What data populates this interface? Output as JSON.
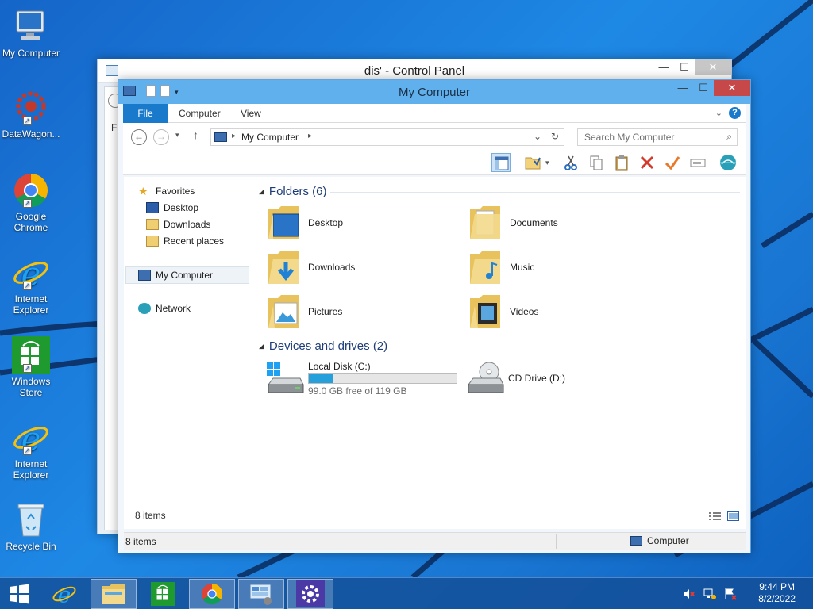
{
  "desktop": {
    "icons": [
      {
        "label": "My Computer",
        "icon": "computer-icon"
      },
      {
        "label": "DataWagon...",
        "icon": "datawagon-icon"
      },
      {
        "label": "Google Chrome",
        "icon": "chrome-icon"
      },
      {
        "label": "Internet Explorer",
        "icon": "ie-icon"
      },
      {
        "label": "Windows Store",
        "icon": "store-icon"
      },
      {
        "label": "Internet Explorer",
        "icon": "ie-icon"
      },
      {
        "label": "Recycle Bin",
        "icon": "recycle-bin-icon"
      }
    ]
  },
  "control_panel": {
    "title": "dis' - Control Panel",
    "strip_text": "Fi"
  },
  "explorer": {
    "title": "My Computer",
    "tabs": {
      "file": "File",
      "computer": "Computer",
      "view": "View"
    },
    "address": "My Computer",
    "search_placeholder": "Search My Computer",
    "nav_pane": {
      "favorites": "Favorites",
      "desktop": "Desktop",
      "downloads": "Downloads",
      "recent": "Recent places",
      "my_computer": "My Computer",
      "network": "Network"
    },
    "folders_header": "Folders (6)",
    "folders": [
      {
        "name": "Desktop",
        "icon": "folder-desktop-icon"
      },
      {
        "name": "Documents",
        "icon": "folder-documents-icon"
      },
      {
        "name": "Downloads",
        "icon": "folder-downloads-icon"
      },
      {
        "name": "Music",
        "icon": "folder-music-icon"
      },
      {
        "name": "Pictures",
        "icon": "folder-pictures-icon"
      },
      {
        "name": "Videos",
        "icon": "folder-videos-icon"
      }
    ],
    "devices_header": "Devices and drives (2)",
    "drives": [
      {
        "name": "Local Disk (C:)",
        "free_text": "99.0 GB free of 119 GB",
        "used_fraction": 0.168,
        "icon": "hard-drive-icon"
      },
      {
        "name": "CD Drive (D:)",
        "icon": "cd-drive-icon"
      }
    ],
    "inner_status": "8 items",
    "status_left": "8 items",
    "status_right": "Computer"
  },
  "taskbar": {
    "buttons": [
      "start-icon",
      "ie-icon",
      "file-explorer-icon",
      "store-icon",
      "chrome-icon",
      "control-panel-icon",
      "settings-icon"
    ],
    "time": "9:44 PM",
    "date": "8/2/2022"
  },
  "colors": {
    "accent": "#1979ca",
    "title_active": "#5fb0ec",
    "close_red": "#c74848",
    "drive_fill": "#26a0da"
  }
}
